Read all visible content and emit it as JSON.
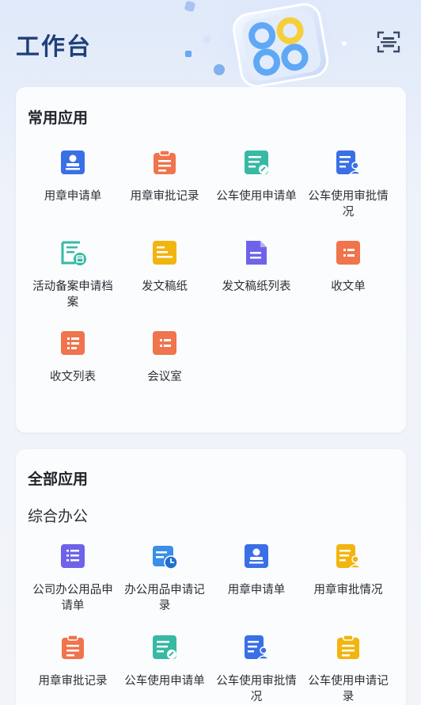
{
  "header": {
    "title": "工作台"
  },
  "common": {
    "title": "常用应用",
    "apps": [
      {
        "label": "用章申请单",
        "icon": "seal-person-icon",
        "color": "#3a6fe6"
      },
      {
        "label": "用章审批记录",
        "icon": "clipboard-list-icon",
        "color": "#f0744c"
      },
      {
        "label": "公车使用申请单",
        "icon": "doc-edit-icon",
        "color": "#37b9a4"
      },
      {
        "label": "公车使用审批情况",
        "icon": "doc-person-icon",
        "color": "#3a6fe6"
      },
      {
        "label": "活动备案申请档案",
        "icon": "archive-calendar-icon",
        "color": "#37b9a4"
      },
      {
        "label": "发文稿纸",
        "icon": "draft-paper-icon",
        "color": "#f2b50f"
      },
      {
        "label": "发文稿纸列表",
        "icon": "document-list-icon",
        "color": "#6e63e8"
      },
      {
        "label": "收文单",
        "icon": "receipt-icon",
        "color": "#f0744c"
      },
      {
        "label": "收文列表",
        "icon": "receipt-list-icon",
        "color": "#f0744c"
      },
      {
        "label": "会议室",
        "icon": "meeting-room-icon",
        "color": "#f0744c"
      }
    ]
  },
  "all": {
    "title": "全部应用",
    "group_title": "综合办公",
    "apps": [
      {
        "label": "公司办公用品申请单",
        "icon": "list-icon",
        "color": "#6e63e8"
      },
      {
        "label": "办公用品申请记录",
        "icon": "calendar-clock-icon",
        "color": "#3a8fe6"
      },
      {
        "label": "用章申请单",
        "icon": "seal-person-icon",
        "color": "#3a6fe6"
      },
      {
        "label": "用章审批情况",
        "icon": "doc-person-icon",
        "color": "#f2b50f"
      },
      {
        "label": "用章审批记录",
        "icon": "clipboard-list-icon",
        "color": "#f0744c"
      },
      {
        "label": "公车使用申请单",
        "icon": "doc-edit-icon",
        "color": "#37b9a4"
      },
      {
        "label": "公车使用审批情况",
        "icon": "doc-person-icon",
        "color": "#3a6fe6"
      },
      {
        "label": "公车使用申请记录",
        "icon": "clipboard-list-icon",
        "color": "#f2b50f"
      }
    ]
  }
}
